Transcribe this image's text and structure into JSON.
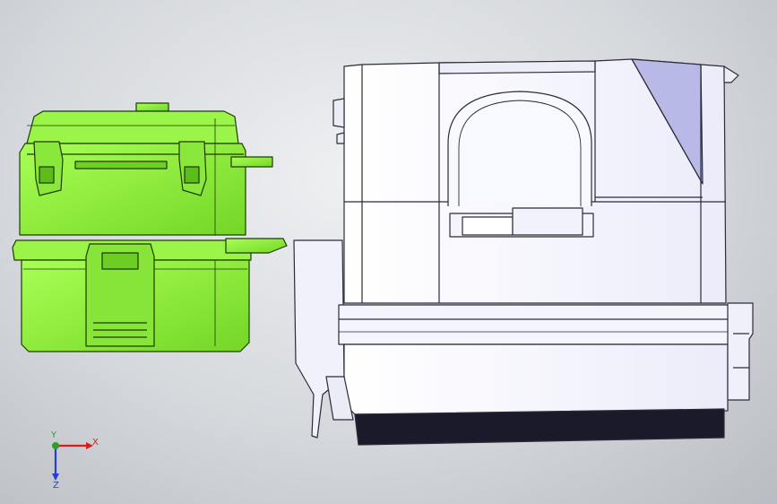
{
  "viewport": {
    "background_top": "#eef0f2",
    "background_bottom": "#b9bdc3"
  },
  "models": [
    {
      "name": "green-box-part",
      "color": "#8ef03a",
      "outline": "#1f3a05"
    },
    {
      "name": "white-housing-part",
      "color": "#f7f7ff",
      "outline": "#2b2b3a",
      "shade": "#b9b9e8"
    }
  ],
  "triad": {
    "x_label": "X",
    "y_label": "Y",
    "z_label": "Z",
    "x_color": "#e01b1b",
    "y_color": "#2aa02a",
    "z_color": "#2a3cd8"
  }
}
